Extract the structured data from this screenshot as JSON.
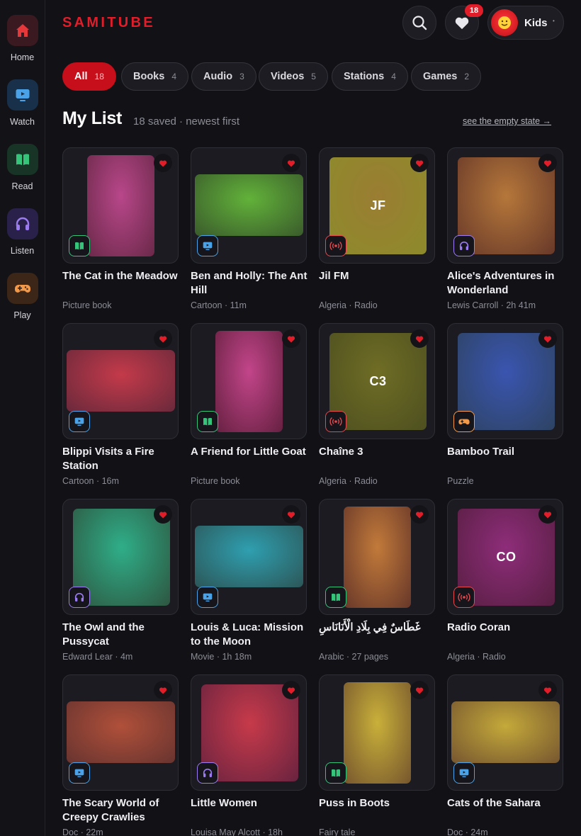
{
  "app": {
    "name": "SAMITUBE",
    "accent": "#e11d2a"
  },
  "sidebar": {
    "items": [
      {
        "label": "Home",
        "icon": "home-icon",
        "color": "#e5383b"
      },
      {
        "label": "Watch",
        "icon": "tv-icon",
        "color": "#4aa3e8"
      },
      {
        "label": "Read",
        "icon": "book-icon",
        "color": "#35c47a"
      },
      {
        "label": "Listen",
        "icon": "headphones-icon",
        "color": "#9b7cf0"
      },
      {
        "label": "Play",
        "icon": "gamepad-icon",
        "color": "#f39a4a"
      }
    ]
  },
  "header": {
    "search_icon": "search-icon",
    "favorites": {
      "icon": "heart-icon",
      "badge": "18"
    },
    "profile": {
      "name": "Kids",
      "avatar_icon": "smiley-icon",
      "caret": "•"
    }
  },
  "filters": [
    {
      "label": "All",
      "count": "18",
      "active": true
    },
    {
      "label": "Books",
      "count": "4",
      "active": false
    },
    {
      "label": "Audio",
      "count": "3",
      "active": false
    },
    {
      "label": "Videos",
      "count": "5",
      "active": false
    },
    {
      "label": "Stations",
      "count": "4",
      "active": false
    },
    {
      "label": "Games",
      "count": "2",
      "active": false
    }
  ],
  "section": {
    "title": "My List",
    "subtitle": "18 saved · newest first",
    "empty_state_link": "see the empty state →"
  },
  "type_colors": {
    "book": "#35c47a",
    "video": "#4aa3e8",
    "radio": "#e5484d",
    "audio": "#9b7cf0",
    "game": "#f39a4a"
  },
  "cards": [
    {
      "title": "The Cat in the Meadow",
      "meta": "Picture book",
      "type": "book",
      "shape": "portrait",
      "art_text": "",
      "colors": [
        "#b8478a",
        "#6e2a4c"
      ]
    },
    {
      "title": "Ben and Holly: The Ant Hill",
      "meta": "Cartoon · 11m",
      "type": "video",
      "shape": "landscape",
      "art_text": "",
      "colors": [
        "#62b23a",
        "#3c5f2c"
      ]
    },
    {
      "title": "Jil FM",
      "meta": "Algeria · Radio",
      "type": "radio",
      "shape": "square",
      "art_text": "JF",
      "colors": [
        "#9a7d32",
        "#8e8a2c"
      ]
    },
    {
      "title": "Alice's Adventures in Wonderland",
      "meta": "Lewis Carroll · 2h 41m",
      "type": "audio",
      "shape": "square",
      "art_text": "",
      "colors": [
        "#b5773a",
        "#6b3b2a"
      ]
    },
    {
      "title": "Blippi Visits a Fire Station",
      "meta": "Cartoon · 16m",
      "type": "video",
      "shape": "landscape",
      "art_text": "",
      "colors": [
        "#c43a4a",
        "#6e2a3c"
      ]
    },
    {
      "title": "A Friend for Little Goat",
      "meta": "Picture book",
      "type": "book",
      "shape": "portrait",
      "art_text": "",
      "colors": [
        "#c2458a",
        "#6a2244"
      ]
    },
    {
      "title": "Chaîne 3",
      "meta": "Algeria · Radio",
      "type": "radio",
      "shape": "square",
      "art_text": "C3",
      "colors": [
        "#6f6d25",
        "#4f5120"
      ]
    },
    {
      "title": "Bamboo Trail",
      "meta": "Puzzle",
      "type": "game",
      "shape": "square",
      "art_text": "",
      "colors": [
        "#3a55b0",
        "#2e4466"
      ]
    },
    {
      "title": "The Owl and the Pussycat",
      "meta": "Edward Lear · 4m",
      "type": "audio",
      "shape": "square",
      "art_text": "",
      "colors": [
        "#2fae88",
        "#2e5a44"
      ]
    },
    {
      "title": "Louis & Luca: Mission to the Moon",
      "meta": "Movie · 1h 18m",
      "type": "video",
      "shape": "landscape",
      "art_text": "",
      "colors": [
        "#2f9fb0",
        "#2c5a5c"
      ]
    },
    {
      "title": "غَطَاسٌ فِي بِلَادِ الْأَنَانَاسِ",
      "meta": "Arabic · 27 pages",
      "type": "book",
      "shape": "portrait",
      "art_text": "",
      "colors": [
        "#c27a3a",
        "#6b3a2a"
      ]
    },
    {
      "title": "Radio Coran",
      "meta": "Algeria · Radio",
      "type": "radio",
      "shape": "square",
      "art_text": "CO",
      "colors": [
        "#8e2d7a",
        "#5a1f44"
      ]
    },
    {
      "title": "The Scary World of Creepy Crawlies",
      "meta": "Doc · 22m",
      "type": "video",
      "shape": "landscape",
      "art_text": "",
      "colors": [
        "#b0503a",
        "#6b3530"
      ]
    },
    {
      "title": "Little Women",
      "meta": "Louisa May Alcott · 18h",
      "type": "audio",
      "shape": "square",
      "art_text": "",
      "colors": [
        "#c73a4a",
        "#6e2440"
      ]
    },
    {
      "title": "Puss in Boots",
      "meta": "Fairy tale",
      "type": "book",
      "shape": "portrait",
      "art_text": "",
      "colors": [
        "#c9b03a",
        "#7a5a2e"
      ]
    },
    {
      "title": "Cats of the Sahara",
      "meta": "Doc · 24m",
      "type": "video",
      "shape": "landscape",
      "art_text": "",
      "colors": [
        "#c4a93a",
        "#7a5a30"
      ]
    }
  ]
}
